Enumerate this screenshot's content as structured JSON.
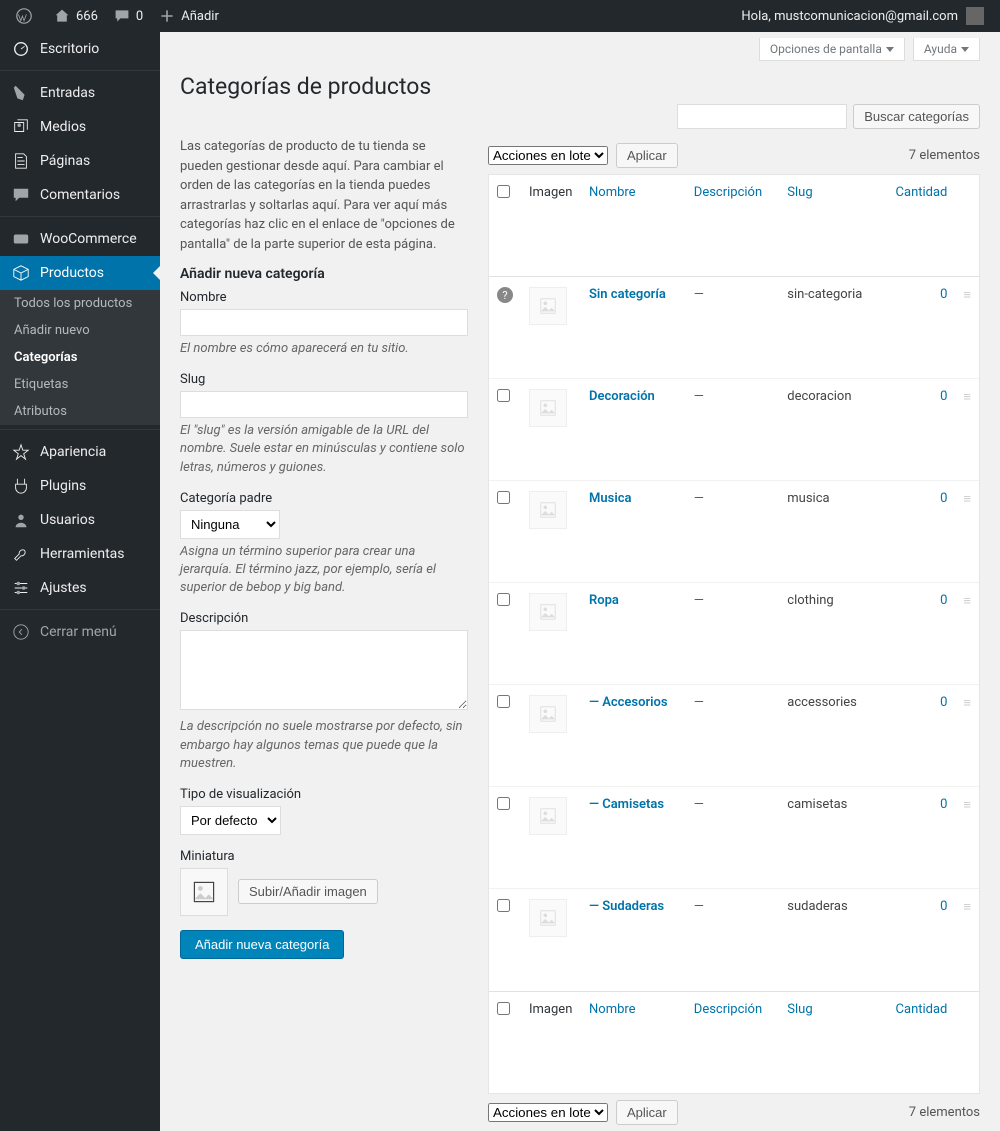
{
  "adminbar": {
    "site_name": "666",
    "comments": "0",
    "add_new": "Añadir",
    "greeting": "Hola, mustcomunicacion@gmail.com"
  },
  "menu": {
    "items": [
      {
        "label": "Escritorio",
        "icon": "dashboard"
      },
      {
        "label": "Entradas",
        "icon": "pin"
      },
      {
        "label": "Medios",
        "icon": "media"
      },
      {
        "label": "Páginas",
        "icon": "pages"
      },
      {
        "label": "Comentarios",
        "icon": "comments"
      },
      {
        "label": "WooCommerce",
        "icon": "woo"
      },
      {
        "label": "Productos",
        "icon": "box",
        "current": true
      },
      {
        "label": "Apariencia",
        "icon": "brush"
      },
      {
        "label": "Plugins",
        "icon": "plug"
      },
      {
        "label": "Usuarios",
        "icon": "user"
      },
      {
        "label": "Herramientas",
        "icon": "wrench"
      },
      {
        "label": "Ajustes",
        "icon": "sliders"
      },
      {
        "label": "Cerrar menú",
        "icon": "collapse"
      }
    ],
    "submenu": [
      {
        "label": "Todos los productos"
      },
      {
        "label": "Añadir nuevo"
      },
      {
        "label": "Categorías",
        "current": true
      },
      {
        "label": "Etiquetas"
      },
      {
        "label": "Atributos"
      }
    ]
  },
  "screen_opts": {
    "options": "Opciones de pantalla",
    "help": "Ayuda"
  },
  "page": {
    "title": "Categorías de productos"
  },
  "search": {
    "button": "Buscar categorías"
  },
  "intro": "Las categorías de producto de tu tienda se pueden gestionar desde aquí. Para cambiar el orden de las categorías en la tienda puedes arrastrarlas y soltarlas aquí. Para ver aquí más categorías haz clic en el enlace de \"opciones de pantalla\" de la parte superior de esta página.",
  "form": {
    "heading": "Añadir nueva categoría",
    "name": {
      "label": "Nombre",
      "help": "El nombre es cómo aparecerá en tu sitio."
    },
    "slug": {
      "label": "Slug",
      "help": "El \"slug\" es la versión amigable de la URL del nombre. Suele estar en minúsculas y contiene solo letras, números y guiones."
    },
    "parent": {
      "label": "Categoría padre",
      "selected": "Ninguna",
      "help": "Asigna un término superior para crear una jerarquía. El término jazz, por ejemplo, sería el superior de bebop y big band."
    },
    "desc": {
      "label": "Descripción",
      "help": "La descripción no suele mostrarse por defecto, sin embargo hay algunos temas que puede que la muestren."
    },
    "display": {
      "label": "Tipo de visualización",
      "selected": "Por defecto"
    },
    "thumb": {
      "label": "Miniatura",
      "button": "Subir/Añadir imagen"
    },
    "submit": "Añadir nueva categoría"
  },
  "bulk": {
    "selected": "Acciones en lote",
    "apply": "Aplicar"
  },
  "count_text": "7 elementos",
  "columns": {
    "image": "Imagen",
    "name": "Nombre",
    "desc": "Descripción",
    "slug": "Slug",
    "count": "Cantidad"
  },
  "rows": [
    {
      "name": "Sin categoría",
      "desc": "—",
      "slug": "sin-categoria",
      "count": "0",
      "help": true
    },
    {
      "name": "Decoración",
      "desc": "—",
      "slug": "decoracion",
      "count": "0"
    },
    {
      "name": "Musica",
      "desc": "—",
      "slug": "musica",
      "count": "0"
    },
    {
      "name": "Ropa",
      "desc": "—",
      "slug": "clothing",
      "count": "0"
    },
    {
      "name": "— Accesorios",
      "desc": "—",
      "slug": "accessories",
      "count": "0"
    },
    {
      "name": "— Camisetas",
      "desc": "—",
      "slug": "camisetas",
      "count": "0"
    },
    {
      "name": "— Sudaderas",
      "desc": "—",
      "slug": "sudaderas",
      "count": "0"
    }
  ]
}
